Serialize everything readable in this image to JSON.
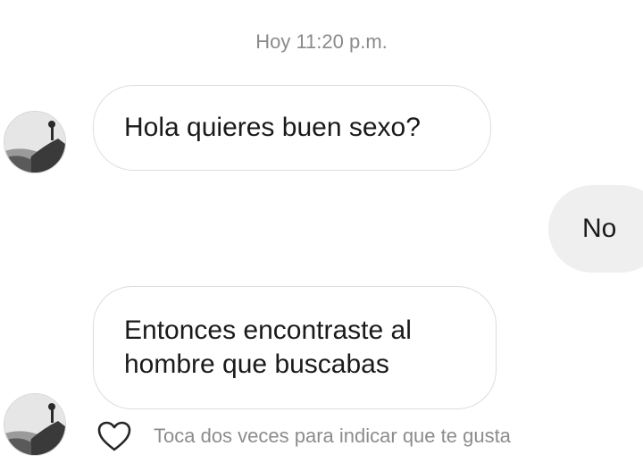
{
  "thread": {
    "timestamp": "Hoy 11:20 p.m.",
    "messages": [
      {
        "sender": "other",
        "text": "Hola quieres buen sexo?"
      },
      {
        "sender": "me",
        "text": "No"
      },
      {
        "sender": "other",
        "text": "Entonces encontraste al hombre que buscabas"
      }
    ],
    "like_hint": "Toca dos veces para indicar que te gusta"
  },
  "icons": {
    "like": "heart-outline-icon",
    "avatar": "profile-photo"
  },
  "colors": {
    "background": "#ffffff",
    "incoming_bubble_border": "#dcdcdc",
    "outgoing_bubble_fill": "#efefef",
    "muted_text": "#8a8a8a"
  }
}
